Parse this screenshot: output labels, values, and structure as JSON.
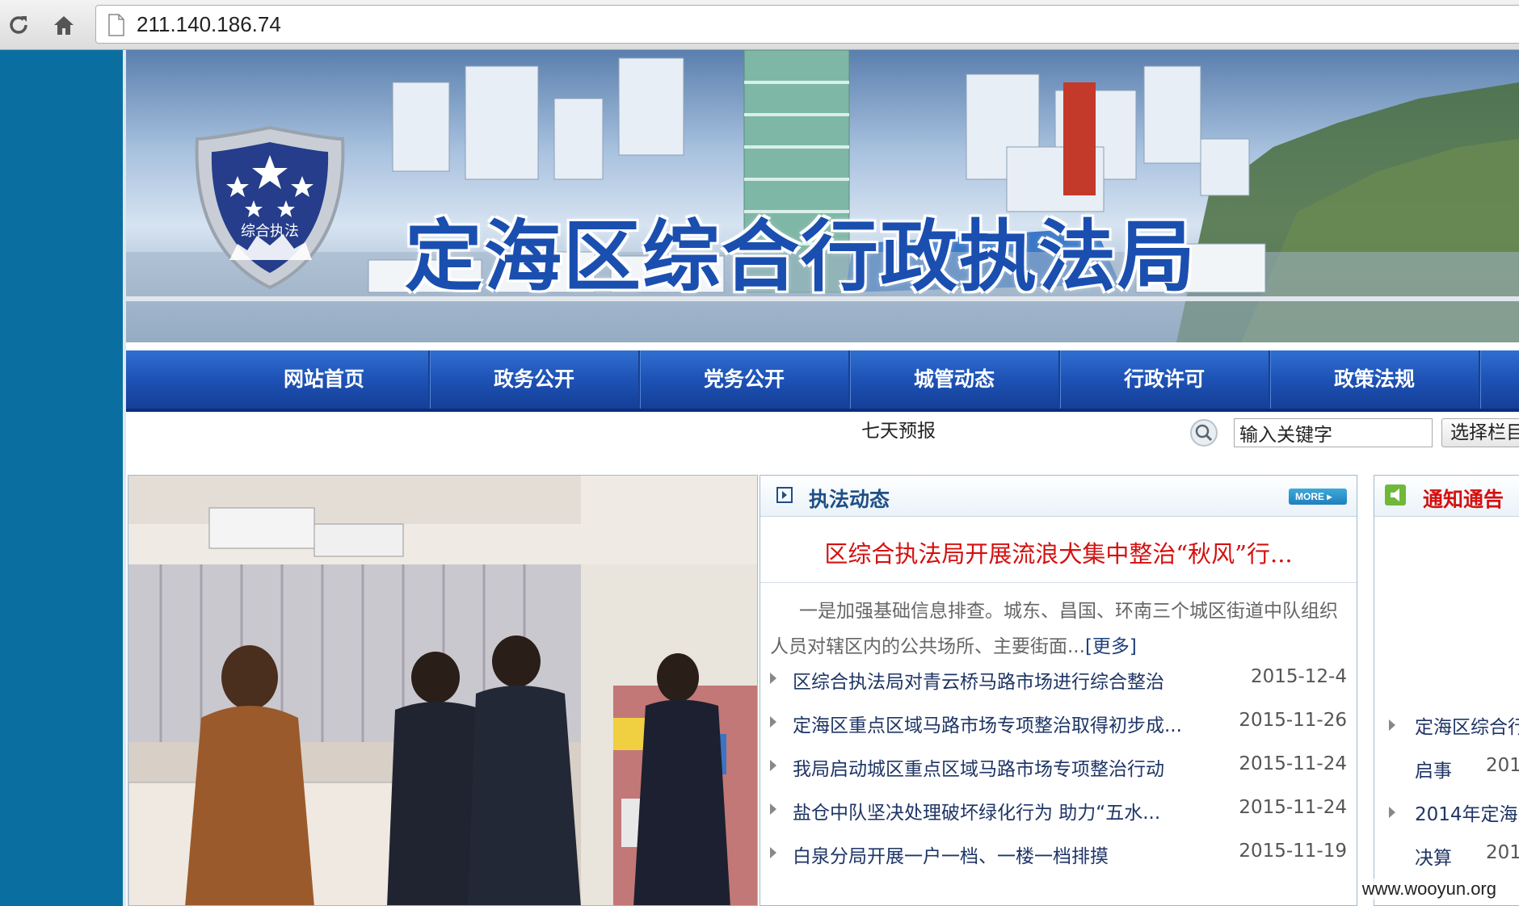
{
  "browser": {
    "url": "211.140.186.74"
  },
  "banner": {
    "title": "定海区综合行政执法局",
    "emblem_text": "综合执法"
  },
  "nav": {
    "items": [
      {
        "label": "网站首页"
      },
      {
        "label": "政务公开"
      },
      {
        "label": "党务公开"
      },
      {
        "label": "城管动态"
      },
      {
        "label": "行政许可"
      },
      {
        "label": "政策法规"
      }
    ]
  },
  "subbar": {
    "forecast": "七天预报",
    "search_value": "输入关键字",
    "select_label": "选择栏目"
  },
  "news": {
    "title": "执法动态",
    "more_label": "MORE ▸",
    "headline": "区综合执法局开展流浪犬集中整治“秋风”行...",
    "summary": "一是加强基础信息排查。城东、昌国、环南三个城区街道中队组织人员对辖区内的公共场所、主要街面...",
    "summary_more": "[更多]",
    "items": [
      {
        "title": "区综合执法局对青云桥马路市场进行综合整治",
        "date": "2015-12-4"
      },
      {
        "title": "定海区重点区域马路市场专项整治取得初步成...",
        "date": "2015-11-26"
      },
      {
        "title": "我局启动城区重点区域马路市场专项整治行动",
        "date": "2015-11-24"
      },
      {
        "title": "盐仓中队坚决处理破坏绿化行为 助力“五水...",
        "date": "2015-11-24"
      },
      {
        "title": "白泉分局开展一户一档、一楼一档排摸",
        "date": "2015-11-19"
      }
    ]
  },
  "notice": {
    "title": "通知通告",
    "items": [
      {
        "title": "定海区综合行",
        "date": ""
      },
      {
        "title": "启事",
        "date": "201"
      },
      {
        "title": "2014年定海",
        "date": ""
      },
      {
        "title": "决算",
        "date": "201"
      }
    ]
  },
  "watermark": "www.wooyun.org",
  "colors": {
    "left_band": "#0a6fa0",
    "nav_blue": "#1e52b5",
    "headline_red": "#d41010"
  }
}
